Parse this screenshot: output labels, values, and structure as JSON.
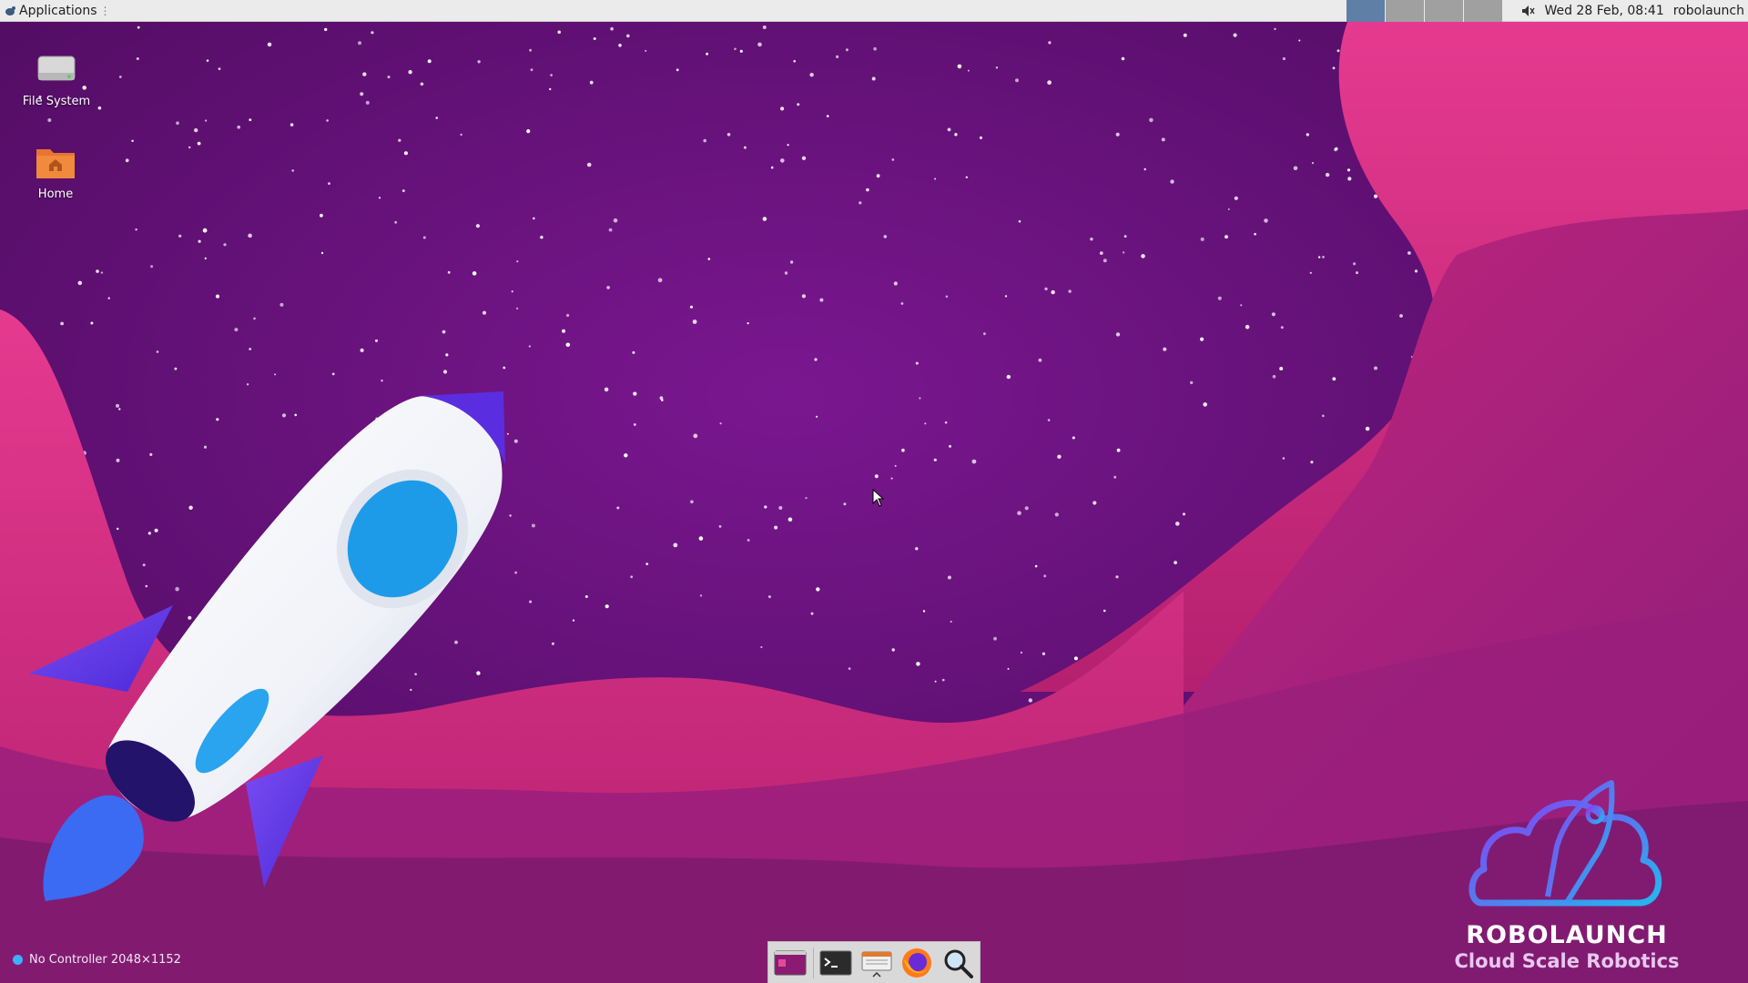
{
  "top_panel": {
    "applications_label": "Applications",
    "workspaces": [
      "1",
      "2",
      "3",
      "4"
    ],
    "active_workspace": 1,
    "clock": "Wed 28 Feb, 08:41",
    "user": "robolaunch"
  },
  "desktop_icons": [
    {
      "label": "File System",
      "icon": "drive-icon"
    },
    {
      "label": "Home",
      "icon": "home-folder-icon"
    }
  ],
  "dock": {
    "items": [
      {
        "name": "show-desktop",
        "icon": "desktop-icon"
      },
      {
        "name": "terminal",
        "icon": "terminal-icon"
      },
      {
        "name": "file-manager",
        "icon": "file-manager-icon"
      },
      {
        "name": "firefox",
        "icon": "firefox-icon"
      },
      {
        "name": "app-finder",
        "icon": "search-icon"
      }
    ]
  },
  "status": {
    "text": "No Controller 2048×1152",
    "dot_color": "#3cb0ff"
  },
  "branding": {
    "name": "ROBOLAUNCH",
    "tagline": "Cloud Scale Robotics"
  },
  "colors": {
    "panel": "#ebebeb",
    "sky": "#5e0f6e",
    "wave_pink": "#e0338a",
    "rocket_blue": "#1e9be8",
    "fin_purple": "#6a3cf0"
  }
}
